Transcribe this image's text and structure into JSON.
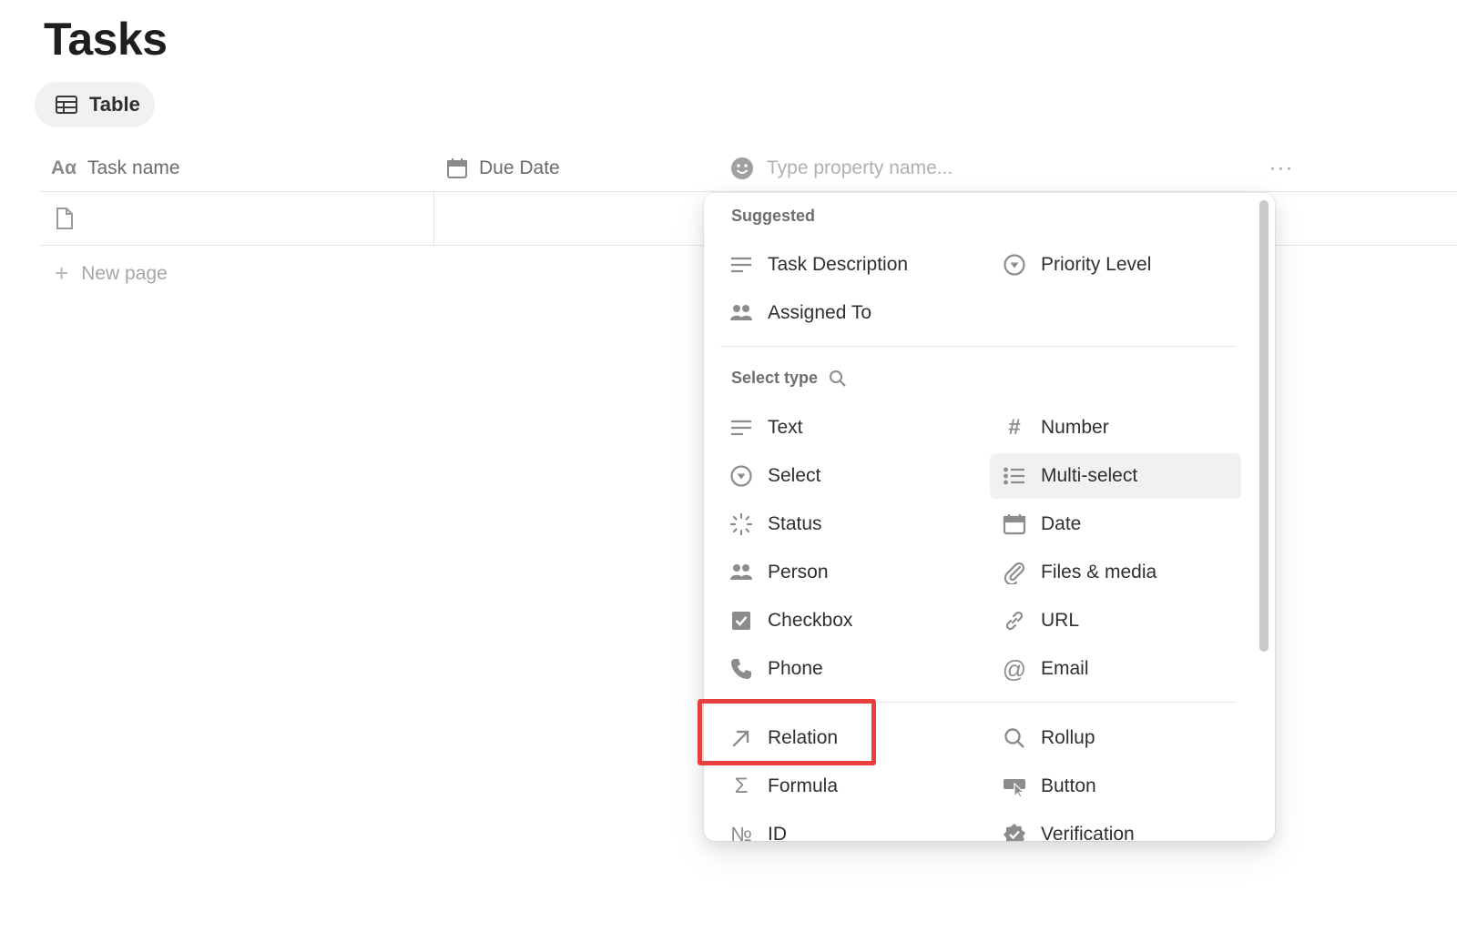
{
  "page": {
    "title": "Tasks"
  },
  "view_tab": {
    "label": "Table",
    "icon": "table-icon"
  },
  "table": {
    "columns": [
      {
        "label": "Task name",
        "icon": "text-aa-icon",
        "icon_glyph": "Aα"
      },
      {
        "label": "Due Date",
        "icon": "calendar-icon"
      }
    ],
    "new_property_placeholder": "Type property name...",
    "new_page_label": "New page"
  },
  "menu": {
    "suggested_label": "Suggested",
    "suggested": [
      {
        "label": "Task Description",
        "icon": "text-lines-icon"
      },
      {
        "label": "Priority Level",
        "icon": "select-circle-icon"
      },
      {
        "label": "Assigned To",
        "icon": "people-icon"
      }
    ],
    "select_type_label": "Select type",
    "types": [
      {
        "label": "Text",
        "icon": "text-lines-icon"
      },
      {
        "label": "Number",
        "icon": "hash-icon"
      },
      {
        "label": "Select",
        "icon": "select-circle-icon"
      },
      {
        "label": "Multi-select",
        "icon": "list-icon"
      },
      {
        "label": "Status",
        "icon": "status-spinner-icon"
      },
      {
        "label": "Date",
        "icon": "calendar-icon"
      },
      {
        "label": "Person",
        "icon": "people-icon"
      },
      {
        "label": "Files & media",
        "icon": "paperclip-icon"
      },
      {
        "label": "Checkbox",
        "icon": "checkbox-icon"
      },
      {
        "label": "URL",
        "icon": "link-icon"
      },
      {
        "label": "Phone",
        "icon": "phone-icon"
      },
      {
        "label": "Email",
        "icon": "at-icon"
      }
    ],
    "advanced": [
      {
        "label": "Relation",
        "icon": "arrow-up-right-icon"
      },
      {
        "label": "Rollup",
        "icon": "search-icon"
      },
      {
        "label": "Formula",
        "icon": "sigma-icon"
      },
      {
        "label": "Button",
        "icon": "cursor-click-icon"
      },
      {
        "label": "ID",
        "icon": "numero-icon",
        "icon_glyph": "№"
      },
      {
        "label": "Verification",
        "icon": "verified-badge-icon"
      }
    ]
  },
  "colors": {
    "highlight": "#e7403e",
    "icon": "#8c8c8a",
    "hover_bg": "#f1f1ef"
  }
}
